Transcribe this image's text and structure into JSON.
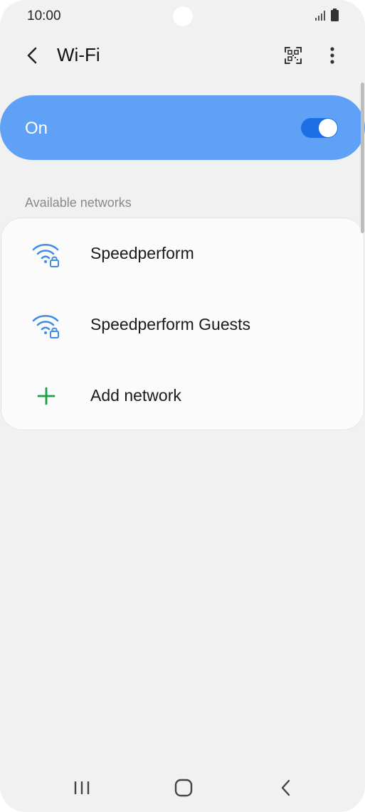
{
  "status_bar": {
    "time": "10:00"
  },
  "header": {
    "title": "Wi-Fi",
    "back_icon": "chevron-left-icon",
    "qr_icon": "qr-code-scan-icon",
    "more_icon": "more-vertical-icon"
  },
  "master_switch": {
    "label": "On",
    "checked": true,
    "color": "#5ea1f7",
    "switch_color": "#1e6fe6"
  },
  "networks_section": {
    "title": "Available networks",
    "items": [
      {
        "label": "Speedperform",
        "icon": "wifi-locked-icon"
      },
      {
        "label": "Speedperform Guests",
        "icon": "wifi-locked-icon"
      },
      {
        "label": "Add network",
        "icon": "plus-icon"
      }
    ]
  },
  "colors": {
    "accent_wifi": "#3d8ce6",
    "accent_add": "#1ca046",
    "background": "#f1f1f1"
  },
  "nav_bar": {
    "items": [
      "recent-apps-icon",
      "home-icon",
      "back-icon"
    ]
  }
}
